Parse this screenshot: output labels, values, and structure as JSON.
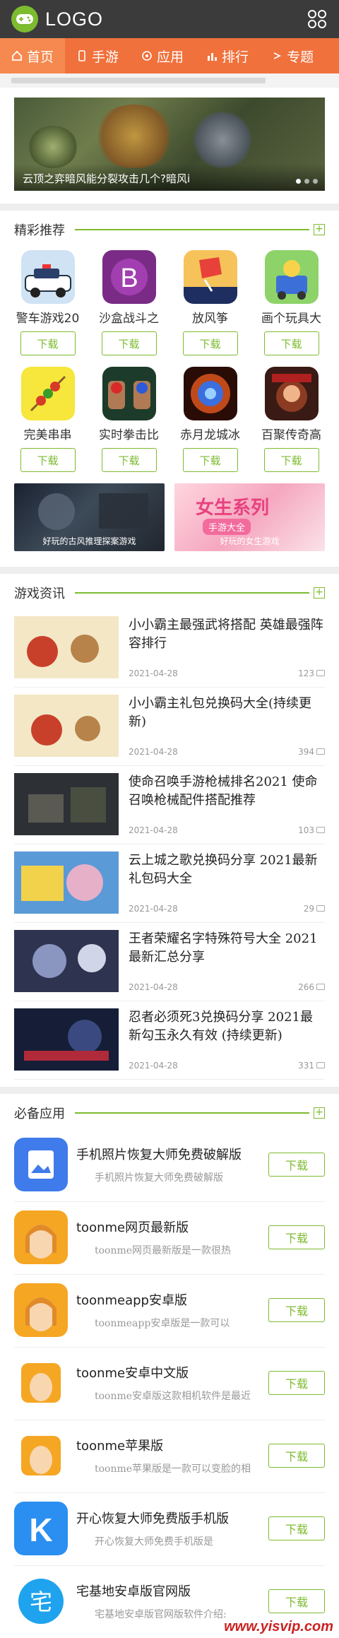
{
  "header": {
    "logo_text": "LOGO"
  },
  "nav": [
    {
      "label": "首页",
      "icon": "home-icon"
    },
    {
      "label": "手游",
      "icon": "phone-icon"
    },
    {
      "label": "应用",
      "icon": "app-icon"
    },
    {
      "label": "排行",
      "icon": "chart-icon"
    },
    {
      "label": "专题",
      "icon": "topic-icon"
    }
  ],
  "banner": {
    "caption": "云顶之弈暗风能分裂攻击几个?暗风i"
  },
  "featured": {
    "title": "精彩推荐",
    "download_label": "下载",
    "apps": [
      {
        "name": "警车游戏20"
      },
      {
        "name": "沙盒战斗之"
      },
      {
        "name": "放风筝"
      },
      {
        "name": "画个玩具大"
      },
      {
        "name": "完美串串"
      },
      {
        "name": "实时拳击比"
      },
      {
        "name": "赤月龙城冰"
      },
      {
        "name": "百聚传奇高"
      }
    ],
    "promos": [
      {
        "caption": "好玩的古风推理探案游戏"
      },
      {
        "title": "女生系列",
        "subtitle": "手游大全",
        "caption": "好玩的女生游戏"
      }
    ]
  },
  "news": {
    "title": "游戏资讯",
    "items": [
      {
        "title": "小小霸主最强武将搭配 英雄最强阵容排行",
        "date": "2021-04-28",
        "comments": "123"
      },
      {
        "title": "小小霸主礼包兑换码大全(持续更新)",
        "date": "2021-04-28",
        "comments": "394"
      },
      {
        "title": "使命召唤手游枪械排名2021 使命召唤枪械配件搭配推荐",
        "date": "2021-04-28",
        "comments": "103"
      },
      {
        "title": "云上城之歌兑换码分享 2021最新礼包码大全",
        "date": "2021-04-28",
        "comments": "29"
      },
      {
        "title": "王者荣耀名字特殊符号大全 2021最新汇总分享",
        "date": "2021-04-28",
        "comments": "266"
      },
      {
        "title": "忍者必须死3兑换码分享 2021最新勾玉永久有效 (持续更新)",
        "date": "2021-04-28",
        "comments": "331"
      }
    ]
  },
  "essential": {
    "title": "必备应用",
    "download_label": "下载",
    "apps": [
      {
        "name": "手机照片恢复大师免费破解版",
        "desc": "手机照片恢复大师免费破解版"
      },
      {
        "name": "toonme网页最新版",
        "desc": "toonme网页最新版是一款很热"
      },
      {
        "name": "toonmeapp安卓版",
        "desc": "toonmeapp安卓版是一款可以"
      },
      {
        "name": "toonme安卓中文版",
        "desc": "toonme安卓版这款相机软件是最近"
      },
      {
        "name": "toonme苹果版",
        "desc": "toonme苹果版是一款可以变脸的相"
      },
      {
        "name": "开心恢复大师免费版手机版",
        "desc": "开心恢复大师免费手机版是"
      },
      {
        "name": "宅基地安卓版官网版",
        "desc": "宅基地安卓版官网版软件介绍:"
      }
    ]
  },
  "watermark": "www.yisvip.com",
  "colors": {
    "accent": "#7dbb2f",
    "nav": "#f0713c",
    "topbar": "#3b3b3b"
  }
}
